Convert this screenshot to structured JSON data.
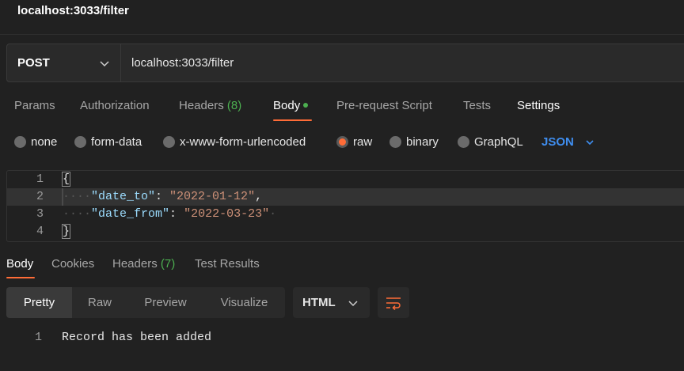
{
  "window": {
    "title": "localhost:3033/filter"
  },
  "request": {
    "method": "POST",
    "url": "localhost:3033/filter"
  },
  "request_tabs": [
    {
      "label": "Params"
    },
    {
      "label": "Authorization"
    },
    {
      "label": "Headers",
      "count": "(8)"
    },
    {
      "label": "Body",
      "active": true
    },
    {
      "label": "Pre-request Script"
    },
    {
      "label": "Tests"
    },
    {
      "label": "Settings"
    }
  ],
  "body_types": [
    {
      "label": "none"
    },
    {
      "label": "form-data"
    },
    {
      "label": "x-www-form-urlencoded"
    },
    {
      "label": "raw",
      "selected": true
    },
    {
      "label": "binary"
    },
    {
      "label": "GraphQL"
    }
  ],
  "raw_format": "JSON",
  "editor": {
    "lines": [
      {
        "num": "1",
        "open": "{"
      },
      {
        "num": "2",
        "key": "\"date_to\"",
        "sep": ": ",
        "value": "\"2022-01-12\"",
        "tail": ","
      },
      {
        "num": "3",
        "key": "\"date_from\"",
        "sep": ": ",
        "value": "\"2022-03-23\"",
        "tail": ""
      },
      {
        "num": "4",
        "close": "}"
      }
    ]
  },
  "response_tabs": [
    {
      "label": "Body",
      "active": true
    },
    {
      "label": "Cookies"
    },
    {
      "label": "Headers",
      "count": "(7)"
    },
    {
      "label": "Test Results"
    }
  ],
  "response_views": [
    {
      "label": "Pretty",
      "active": true
    },
    {
      "label": "Raw"
    },
    {
      "label": "Preview"
    },
    {
      "label": "Visualize"
    }
  ],
  "response_format": "HTML",
  "response_body": {
    "line_num": "1",
    "text": "Record has been added"
  },
  "colors": {
    "accent": "#ff6c37",
    "json_blue": "#3f8ef0",
    "count_green": "#4caf50",
    "json_key": "#9cdcfe",
    "json_string": "#ce9178"
  },
  "icons": {
    "method_dropdown": "chevron-down-icon",
    "format_dropdown": "chevron-down-icon",
    "wrap": "wrap-lines-icon"
  }
}
